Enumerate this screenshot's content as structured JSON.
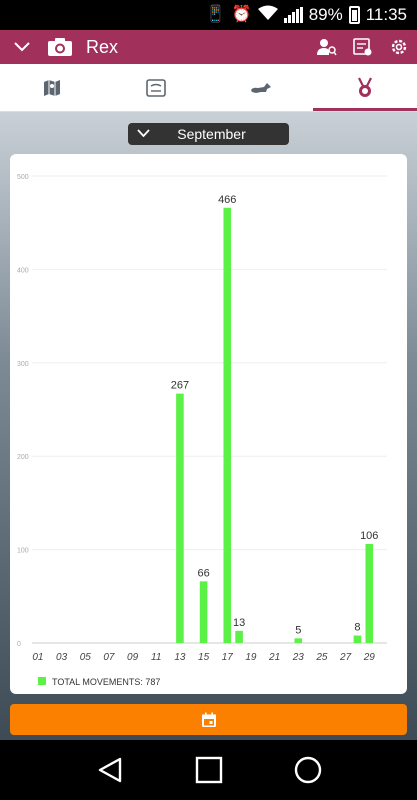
{
  "status_bar": {
    "battery": "89%",
    "time": "11:35"
  },
  "app_bar": {
    "title": "Rex"
  },
  "tabs": [
    {
      "icon": "map-icon"
    },
    {
      "icon": "certificate-icon"
    },
    {
      "icon": "dog-walk-icon"
    },
    {
      "icon": "medal-icon",
      "active": true
    }
  ],
  "month_selector": {
    "value": "September"
  },
  "colors": {
    "brand": "#a1305a",
    "bar": "#5cf147",
    "accent": "#fb8000"
  },
  "chart_data": {
    "type": "bar",
    "categories": [
      "01",
      "02",
      "03",
      "04",
      "05",
      "06",
      "07",
      "08",
      "09",
      "10",
      "11",
      "12",
      "13",
      "14",
      "15",
      "16",
      "17",
      "18",
      "19",
      "20",
      "21",
      "22",
      "23",
      "24",
      "25",
      "26",
      "27",
      "28",
      "29",
      "30"
    ],
    "x_tick_labels": [
      "01",
      "03",
      "05",
      "07",
      "09",
      "11",
      "13",
      "15",
      "17",
      "19",
      "21",
      "23",
      "25",
      "27",
      "29"
    ],
    "series": [
      {
        "name": "TOTAL MOVEMENTS: 787",
        "values": [
          0,
          0,
          0,
          0,
          0,
          0,
          0,
          0,
          0,
          0,
          0,
          0,
          267,
          0,
          66,
          0,
          466,
          13,
          0,
          0,
          0,
          0,
          5,
          0,
          0,
          0,
          0,
          8,
          106,
          0
        ]
      }
    ],
    "ylim": [
      0,
      500
    ],
    "y_ticks": [
      0,
      100,
      200,
      300,
      400,
      500
    ],
    "grid": true,
    "legend": "bottom-left",
    "data_labels": true
  }
}
